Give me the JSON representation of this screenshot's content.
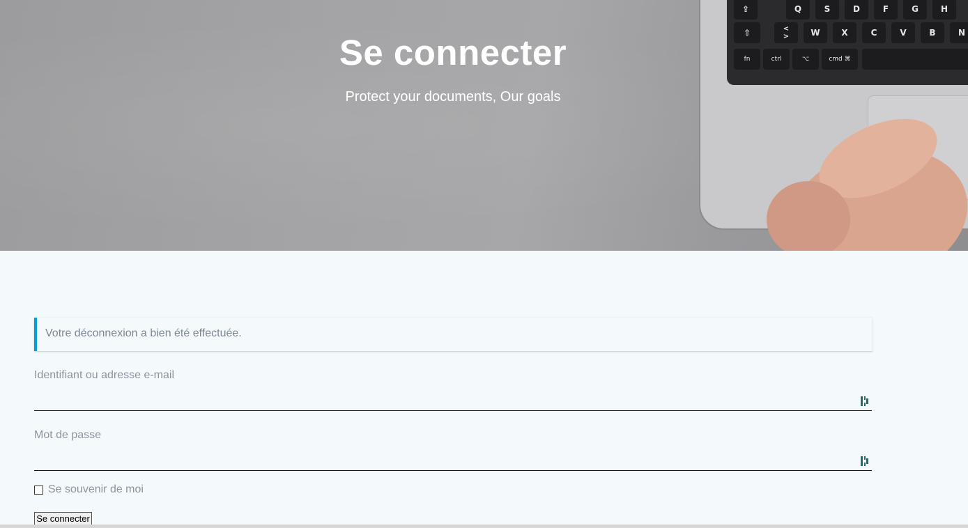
{
  "hero": {
    "title": "Se connecter",
    "subtitle": "Protect your documents, Our goals",
    "keys_row1": [
      "⇪",
      "Q",
      "S",
      "D",
      "F",
      "G",
      "H"
    ],
    "keys_row2": [
      "⇧",
      "<\n>",
      "W",
      "X",
      "C",
      "V",
      "B",
      "N"
    ],
    "keys_row3": [
      "fn",
      "ctrl",
      "⌥",
      "cmd ⌘"
    ]
  },
  "notice": {
    "message": "Votre déconnexion a bien été effectuée."
  },
  "login_form": {
    "username_label": "Identifiant ou adresse e-mail",
    "username_value": "",
    "password_label": "Mot de passe",
    "password_value": "",
    "remember_label": "Se souvenir de moi",
    "remember_checked": false,
    "submit_label": "Se connecter"
  },
  "colors": {
    "notice_accent": "#00a0d2",
    "page_background": "#f4f9fc",
    "password_manager_icon": "#1e6b70"
  },
  "icons": {
    "field_icon": "password-manager-icon"
  }
}
